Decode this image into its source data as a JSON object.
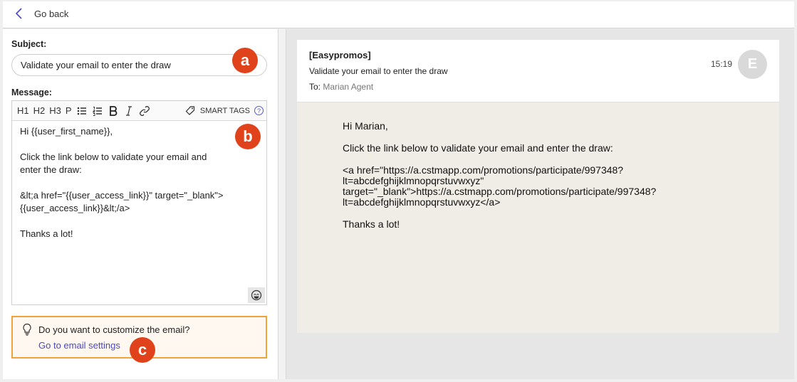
{
  "topbar": {
    "back_label": "Go back"
  },
  "form": {
    "subject_label": "Subject:",
    "subject_value": "Validate your email to enter the draw",
    "message_label": "Message:",
    "toolbar": {
      "h1": "H1",
      "h2": "H2",
      "h3": "H3",
      "p": "P",
      "smart_tags": "SMART TAGS",
      "help": "?"
    },
    "message_lines": [
      "Hi {{user_first_name}},",
      "",
      "Click the link below to validate your email and",
      "enter the draw:",
      "",
      "&lt;a href=\"{{user_access_link}}\" target=\"_blank\">",
      "{{user_access_link}}&lt;/a>",
      "",
      "Thanks a lot!"
    ]
  },
  "tip": {
    "question": "Do you want to customize the email?",
    "link": "Go to email settings"
  },
  "badges": {
    "a": "a",
    "b": "b",
    "c": "c"
  },
  "preview": {
    "sender": "[Easypromos]",
    "subject": "Validate your email to enter the draw",
    "to_label": "To:",
    "to_name": "Marian Agent",
    "time": "15:19",
    "avatar_initial": "E",
    "greeting": "Hi Marian,",
    "instruction": "Click the link below to validate your email and enter the draw:",
    "link_lines": [
      "<a href=\"https://a.cstmapp.com/promotions/participate/997348?",
      "lt=abcdefghijklmnopqrstuvwxyz\"",
      "target=\"_blank\">https://a.cstmapp.com/promotions/participate/997348?",
      "lt=abcdefghijklmnopqrstuvwxyz</a>"
    ],
    "closing": "Thanks a lot!"
  },
  "colors": {
    "accent": "#4a48c4",
    "badge": "#e0421b",
    "tip_border": "#f0a33a"
  },
  "icons": [
    "chevron-left-icon",
    "bullet-list-icon",
    "numbered-list-icon",
    "bold-icon",
    "italic-icon",
    "link-icon",
    "tag-icon",
    "help-icon",
    "emoji-icon",
    "lightbulb-icon"
  ]
}
